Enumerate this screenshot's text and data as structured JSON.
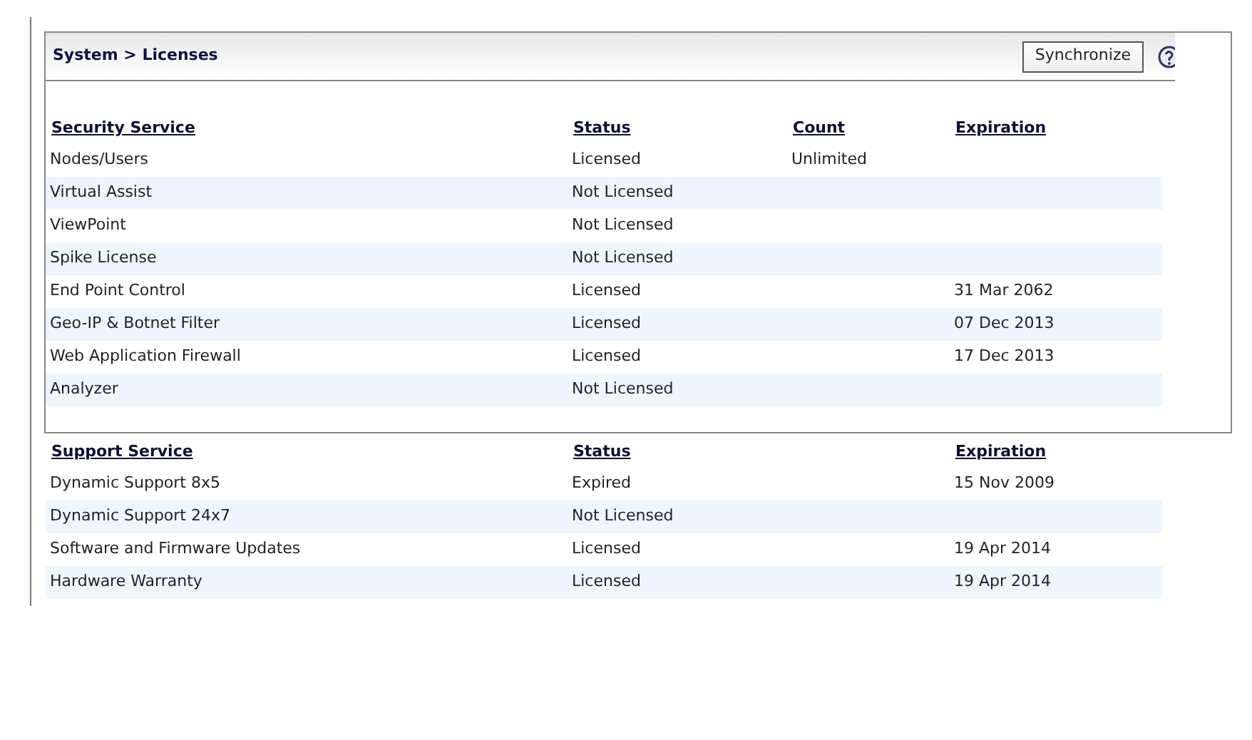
{
  "header": {
    "breadcrumb": "System > Licenses",
    "sync_button": "Synchronize"
  },
  "security": {
    "columns": [
      "Security Service",
      "Status",
      "Count",
      "Expiration"
    ],
    "rows": [
      {
        "service": "Nodes/Users",
        "status": "Licensed",
        "count": "Unlimited",
        "expiration": ""
      },
      {
        "service": "Virtual Assist",
        "status": "Not Licensed",
        "count": "",
        "expiration": ""
      },
      {
        "service": "ViewPoint",
        "status": "Not Licensed",
        "count": "",
        "expiration": ""
      },
      {
        "service": "Spike License",
        "status": "Not Licensed",
        "count": "",
        "expiration": ""
      },
      {
        "service": "End Point Control",
        "status": "Licensed",
        "count": "",
        "expiration": "31 Mar 2062"
      },
      {
        "service": "Geo-IP & Botnet Filter",
        "status": "Licensed",
        "count": "",
        "expiration": "07 Dec 2013"
      },
      {
        "service": "Web Application Firewall",
        "status": "Licensed",
        "count": "",
        "expiration": "17 Dec 2013"
      },
      {
        "service": "Analyzer",
        "status": "Not Licensed",
        "count": "",
        "expiration": ""
      }
    ]
  },
  "support": {
    "columns": [
      "Support Service",
      "Status",
      "",
      "Expiration"
    ],
    "rows": [
      {
        "service": "Dynamic Support 8x5",
        "status": "Expired",
        "expiration": "15 Nov 2009"
      },
      {
        "service": "Dynamic Support 24x7",
        "status": "Not Licensed",
        "expiration": ""
      },
      {
        "service": "Software and Firmware Updates",
        "status": "Licensed",
        "expiration": "19 Apr 2014"
      },
      {
        "service": "Hardware Warranty",
        "status": "Licensed",
        "expiration": "19 Apr 2014"
      }
    ]
  }
}
